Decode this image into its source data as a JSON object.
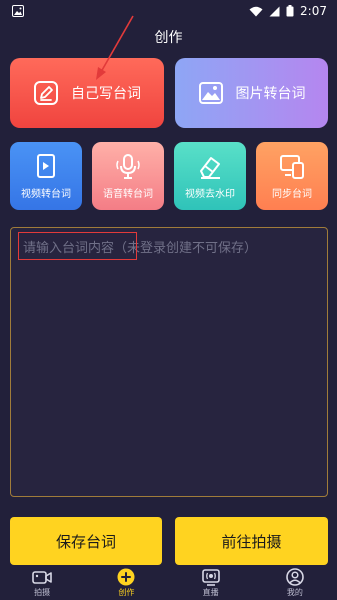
{
  "status_bar": {
    "time": "2:07"
  },
  "header": {
    "title": "创作"
  },
  "feature_cards": {
    "write": "自己写台词",
    "image_to_script": "图片转台词"
  },
  "tools": [
    {
      "label": "视频转台词",
      "icon": "video-file-icon"
    },
    {
      "label": "语音转台词",
      "icon": "microphone-icon"
    },
    {
      "label": "视频去水印",
      "icon": "eraser-icon"
    },
    {
      "label": "同步台词",
      "icon": "sync-devices-icon"
    }
  ],
  "editor": {
    "placeholder": "请输入台词内容（未登录创建不可保存）",
    "value": ""
  },
  "actions": {
    "save": "保存台词",
    "go_shoot": "前往拍摄"
  },
  "tabbar": {
    "items": [
      {
        "label": "拍摄",
        "icon": "camera-icon",
        "active": false
      },
      {
        "label": "创作",
        "icon": "plus-circle-icon",
        "active": true
      },
      {
        "label": "直播",
        "icon": "live-broadcast-icon",
        "active": false
      },
      {
        "label": "我的",
        "icon": "profile-icon",
        "active": false
      }
    ]
  },
  "colors": {
    "background": "#22203a",
    "accent": "#ffd320",
    "annotation": "#e23a3a"
  }
}
